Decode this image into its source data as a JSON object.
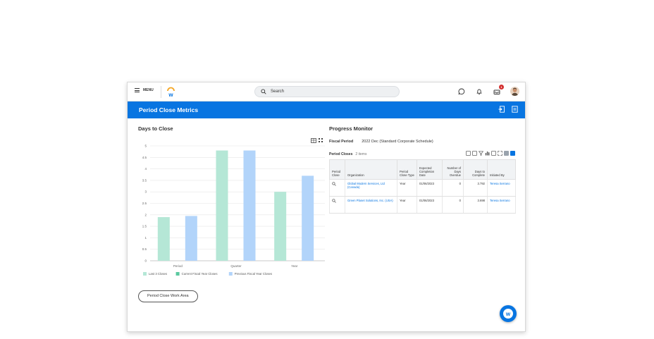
{
  "topbar": {
    "menu_label": "MENU",
    "search_placeholder": "Search",
    "notification_count": "1"
  },
  "page": {
    "title": "Period Close Metrics"
  },
  "left": {
    "title": "Days to Close",
    "action_button": "Period Close Work Area"
  },
  "chart_data": {
    "type": "bar",
    "categories": [
      "Period",
      "Quarter",
      "Year"
    ],
    "series": [
      {
        "name": "Last 3 Closes",
        "values": [
          1.9,
          4.8,
          3.0
        ],
        "color": "#b5e7d6"
      },
      {
        "name": "Current Fiscal Year Closes",
        "values": [
          0,
          0,
          0
        ],
        "color": "#5bc9a0"
      },
      {
        "name": "Previous Fiscal Year Closes",
        "values": [
          1.95,
          4.8,
          3.7
        ],
        "color": "#b2d4fa"
      }
    ],
    "y_ticks": [
      "0",
      "0.5",
      "1",
      "1.5",
      "2",
      "2.5",
      "3",
      "3.5",
      "4",
      "4.5",
      "5"
    ],
    "ylim": [
      0,
      5
    ],
    "grid": true,
    "legend_position": "bottom-left"
  },
  "right": {
    "title": "Progress Monitor",
    "fiscal_period_label": "Fiscal Period",
    "fiscal_period_value": "2022 Dec (Standard Corporate Schedule)",
    "table_title": "Period Closes",
    "table_count": "2 items",
    "columns": [
      "Period Close",
      "Organization",
      "Period Close Type",
      "Expected Completion Date",
      "Number of Days Overdue",
      "Days to Complete",
      "Initiated By"
    ],
    "rows": [
      {
        "org": "Global Modern Services, Ltd (Canada)",
        "type": "Year",
        "date": "01/06/2023",
        "overdue": "0",
        "days": "3.792",
        "by": "Teresa Serrano"
      },
      {
        "org": "Green Planet Solutions, Inc. (USA)",
        "type": "Year",
        "date": "01/06/2023",
        "overdue": "0",
        "days": "3.698",
        "by": "Teresa Serrano"
      }
    ]
  },
  "colors": {
    "brand_blue": "#0875e1",
    "badge_red": "#d3302f"
  }
}
